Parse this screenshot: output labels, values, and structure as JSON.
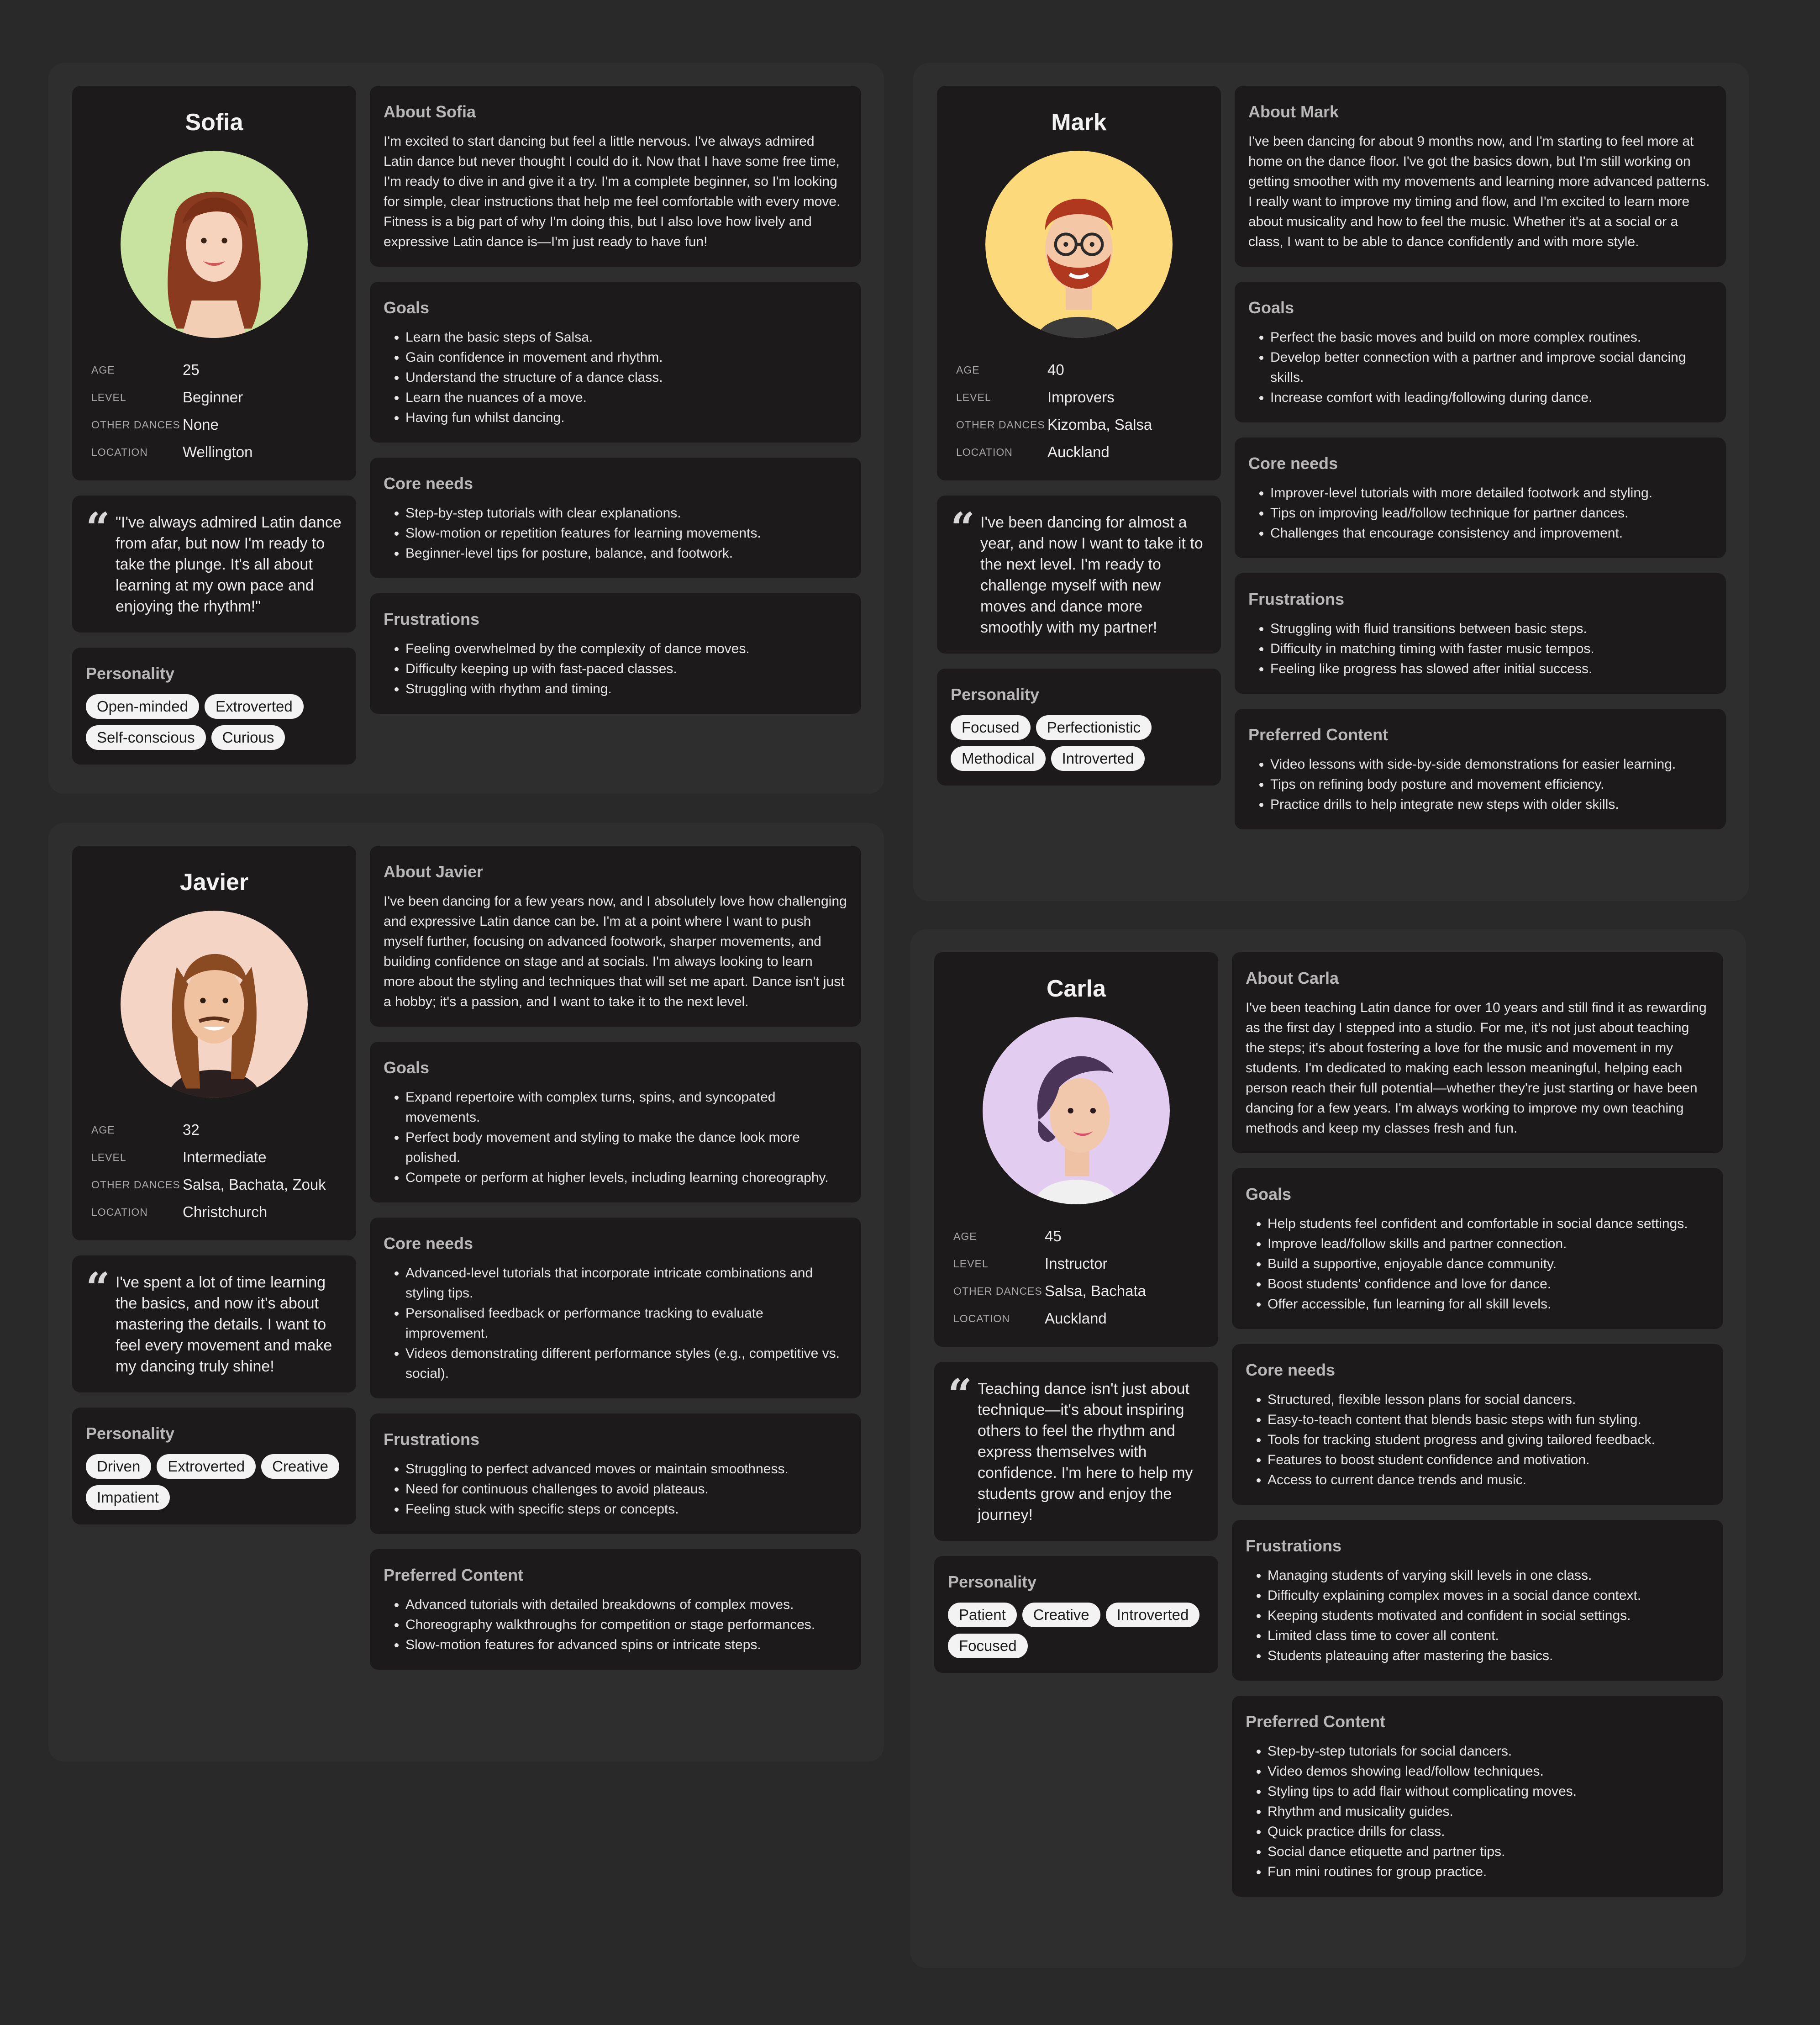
{
  "personas": [
    {
      "id": "sofia",
      "name": "Sofia",
      "facts": [
        {
          "label": "AGE",
          "value": "25"
        },
        {
          "label": "LEVEL",
          "value": "Beginner"
        },
        {
          "label": "OTHER DANCES",
          "value": "None"
        },
        {
          "label": "LOCATION",
          "value": "Wellington"
        }
      ],
      "quote": "\"I've always admired Latin dance from afar, but now I'm ready to take the plunge. It's all about learning at my own pace and enjoying the rhythm!\"",
      "personality_title": "Personality",
      "traits": [
        "Open-minded",
        "Extroverted",
        "Self-conscious",
        "Curious"
      ],
      "about_title": "About Sofia",
      "about": "I'm excited to start dancing but feel a little nervous. I've always admired Latin dance but never thought I could do it. Now that I have some free time, I'm ready to dive in and give it a try. I'm a complete beginner, so I'm looking for simple, clear instructions that help me feel comfortable with every move. Fitness is a big part of why I'm doing this, but I also love how lively and expressive Latin dance is—I'm just ready to have fun!",
      "sections": [
        {
          "title": "Goals",
          "items": [
            "Learn the basic steps of Salsa.",
            "Gain confidence in movement and rhythm.",
            "Understand the structure of a dance class.",
            "Learn the nuances of a move.",
            "Having fun whilst dancing."
          ]
        },
        {
          "title": "Core needs",
          "items": [
            "Step-by-step tutorials with clear explanations.",
            "Slow-motion or repetition features for learning movements.",
            "Beginner-level tips for posture, balance, and footwork."
          ]
        },
        {
          "title": "Frustrations",
          "items": [
            "Feeling overwhelmed by the complexity of dance moves.",
            "Difficulty keeping up with fast-paced classes.",
            "Struggling with rhythm and timing."
          ]
        }
      ]
    },
    {
      "id": "mark",
      "name": "Mark",
      "facts": [
        {
          "label": "AGE",
          "value": "40"
        },
        {
          "label": "LEVEL",
          "value": "Improvers"
        },
        {
          "label": "OTHER DANCES",
          "value": "Kizomba, Salsa"
        },
        {
          "label": "LOCATION",
          "value": "Auckland"
        }
      ],
      "quote": "I've been dancing for almost a year, and now I want to take it to the next level. I'm ready to challenge myself with new moves and dance more smoothly with my partner!",
      "personality_title": "Personality",
      "traits": [
        "Focused",
        "Perfectionistic",
        "Methodical",
        "Introverted"
      ],
      "about_title": "About Mark",
      "about": "I've been dancing for about 9 months now, and I'm starting to feel more at home on the dance floor. I've got the basics down, but I'm still working on getting smoother with my movements and learning more advanced patterns. I really want to improve my timing and flow, and I'm excited to learn more about musicality and how to feel the music. Whether it's at a social or a class, I want to be able to dance confidently and with more style.",
      "sections": [
        {
          "title": "Goals",
          "items": [
            "Perfect the basic moves and build on more complex routines.",
            "Develop better connection with a partner and improve social dancing skills.",
            "Increase comfort with leading/following during dance."
          ]
        },
        {
          "title": "Core needs",
          "items": [
            "Improver-level tutorials with more detailed footwork and styling.",
            "Tips on improving lead/follow technique for partner dances.",
            "Challenges that encourage consistency and improvement."
          ]
        },
        {
          "title": "Frustrations",
          "items": [
            "Struggling with fluid transitions between basic steps.",
            "Difficulty in matching timing with faster music tempos.",
            "Feeling like progress has slowed after initial success."
          ]
        },
        {
          "title": "Preferred Content",
          "items": [
            "Video lessons with side-by-side demonstrations for easier learning.",
            "Tips on refining body posture and movement efficiency.",
            "Practice drills to help integrate new steps with older skills."
          ]
        }
      ]
    },
    {
      "id": "javier",
      "name": "Javier",
      "facts": [
        {
          "label": "AGE",
          "value": "32"
        },
        {
          "label": "LEVEL",
          "value": "Intermediate"
        },
        {
          "label": "OTHER DANCES",
          "value": "Salsa, Bachata, Zouk"
        },
        {
          "label": "LOCATION",
          "value": "Christchurch"
        }
      ],
      "quote": "I've spent a lot of time learning the basics, and now it's about mastering the details. I want to feel every movement and make my dancing truly shine!",
      "personality_title": "Personality",
      "traits": [
        "Driven",
        "Extroverted",
        "Creative",
        "Impatient"
      ],
      "about_title": "About Javier",
      "about": "I've been dancing for a few years now, and I absolutely love how challenging and expressive Latin dance can be. I'm at a point where I want to push myself further, focusing on advanced footwork, sharper movements, and building confidence on stage and at socials. I'm always looking to learn more about the styling and techniques that will set me apart. Dance isn't just a hobby; it's a passion, and I want to take it to the next level.",
      "sections": [
        {
          "title": "Goals",
          "items": [
            "Expand repertoire with complex turns, spins, and syncopated movements.",
            "Perfect body movement and styling to make the dance look more polished.",
            "Compete or perform at higher levels, including learning choreography."
          ]
        },
        {
          "title": "Core needs",
          "items": [
            "Advanced-level tutorials that incorporate intricate combinations and styling tips.",
            "Personalised feedback or performance tracking to evaluate improvement.",
            "Videos demonstrating different performance styles (e.g., competitive vs. social)."
          ]
        },
        {
          "title": "Frustrations",
          "items": [
            "Struggling to perfect advanced moves or maintain smoothness.",
            "Need for continuous challenges to avoid plateaus.",
            "Feeling stuck with specific steps or concepts."
          ]
        },
        {
          "title": "Preferred Content",
          "items": [
            "Advanced tutorials with detailed breakdowns of complex moves.",
            "Choreography walkthroughs for competition or stage performances.",
            "Slow-motion features for advanced spins or intricate steps."
          ]
        }
      ]
    },
    {
      "id": "carla",
      "name": "Carla",
      "facts": [
        {
          "label": "AGE",
          "value": "45"
        },
        {
          "label": "LEVEL",
          "value": "Instructor"
        },
        {
          "label": "OTHER DANCES",
          "value": "Salsa, Bachata"
        },
        {
          "label": "LOCATION",
          "value": "Auckland"
        }
      ],
      "quote": "Teaching dance isn't just about technique—it's about inspiring others to feel the rhythm and express themselves with confidence. I'm here to help my students grow and enjoy the journey!",
      "personality_title": "Personality",
      "traits": [
        "Patient",
        "Creative",
        "Introverted",
        "Focused"
      ],
      "about_title": "About Carla",
      "about": "I've been teaching Latin dance for over 10 years and still find it as rewarding as the first day I stepped into a studio. For me, it's not just about teaching the steps; it's about fostering a love for the music and movement in my students. I'm dedicated to making each lesson meaningful, helping each person reach their full potential—whether they're just starting or have been dancing for a few years. I'm always working to improve my own teaching methods and keep my classes fresh and fun.",
      "sections": [
        {
          "title": "Goals",
          "items": [
            "Help students feel confident and comfortable in social dance settings.",
            "Improve lead/follow skills and partner connection.",
            "Build a supportive, enjoyable dance community.",
            "Boost students' confidence and love for dance.",
            "Offer accessible, fun learning for all skill levels."
          ]
        },
        {
          "title": "Core needs",
          "items": [
            "Structured, flexible lesson plans for social dancers.",
            "Easy-to-teach content that blends basic steps with fun styling.",
            "Tools for tracking student progress and giving tailored feedback.",
            "Features to boost student confidence and motivation.",
            "Access to current dance trends and music."
          ]
        },
        {
          "title": "Frustrations",
          "items": [
            "Managing students of varying skill levels in one class.",
            "Difficulty explaining complex moves in a social dance context.",
            "Keeping students motivated and confident in social settings.",
            "Limited class time to cover all content.",
            "Students plateauing after mastering the basics."
          ]
        },
        {
          "title": "Preferred Content",
          "items": [
            "Step-by-step tutorials for social dancers.",
            "Video demos showing lead/follow techniques.",
            "Styling tips to add flair without complicating moves.",
            "Rhythm and musicality guides.",
            "Quick practice drills for class.",
            "Social dance etiquette and partner tips.",
            "Fun mini routines for group practice."
          ]
        }
      ]
    }
  ]
}
